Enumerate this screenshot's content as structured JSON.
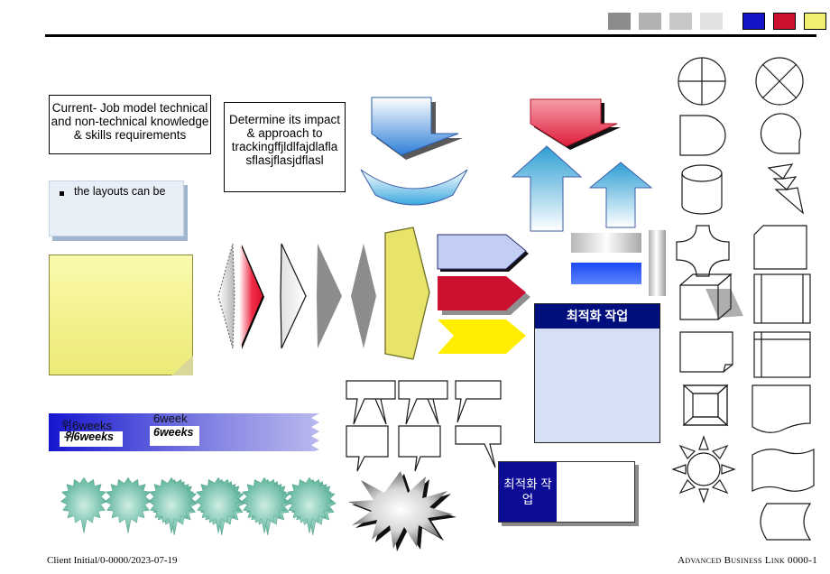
{
  "slide": {
    "title_rule": true,
    "footer_left": "Client Initial/0-0000/2023-07-19",
    "footer_right": "Advanced Business Link  0000-1"
  },
  "swatches": [
    {
      "name": "gray-dark",
      "color": "#8c8c8c",
      "bordered": false
    },
    {
      "name": "gray-mid",
      "color": "#b2b2b2",
      "bordered": false
    },
    {
      "name": "gray-light",
      "color": "#c8c8c8",
      "bordered": false
    },
    {
      "name": "gray-pale",
      "color": "#e2e2e2",
      "bordered": false
    },
    {
      "name": "blue",
      "color": "#1414c8",
      "bordered": true
    },
    {
      "name": "red",
      "color": "#cc1130",
      "bordered": true
    },
    {
      "name": "yellow",
      "color": "#f0ef72",
      "bordered": true
    },
    {
      "name": "teal",
      "color": "#0b6d68",
      "bordered": true
    }
  ],
  "boxes": {
    "current_job": "Current- Job model technical and non-technical knowledge & skills requirements",
    "determine": "Determine its impact & approach to trackingffjldlfajdlafla sflasjflasjdflasl",
    "layouts_bullet": "the layouts can be"
  },
  "banner": {
    "label_top_left": "위6weeks",
    "label_top_right": "6week",
    "label_box_left": "위6weeks",
    "label_box_right": "6weeks"
  },
  "korean": {
    "panel1_title": "최적화 작업",
    "panel2_title": "최적화 작업"
  },
  "starbursts": [
    {
      "name": "starburst-teal",
      "color": "#79c9b4"
    },
    {
      "name": "starburst-yellow",
      "color": "#e8e36a"
    },
    {
      "name": "starburst-white",
      "color": "#ffffff"
    },
    {
      "name": "starburst-navy",
      "color": "#10426f"
    },
    {
      "name": "starburst-blue",
      "color": "#1a1aa8"
    },
    {
      "name": "starburst-red",
      "color": "#d61133"
    }
  ],
  "chevrons": [
    {
      "name": "chevron-lightblue",
      "color": "#c3cef5"
    },
    {
      "name": "chevron-red",
      "color": "#cc1130"
    },
    {
      "name": "chevron-yellow",
      "color": "#ffee00"
    }
  ],
  "arrows": {
    "down_blue": "down-arrow-blue",
    "down_red": "down-arrow-red",
    "up_blue_tall": "up-arrow-blue",
    "up_blue_short": "up-arrow-blue-small",
    "curved_blue": "curved-down-arrow-blue"
  },
  "gradient_bars": {
    "gray": "gradient-bar-gray",
    "blue": "gradient-bar-blue",
    "vertical": "gradient-bar-vertical-gray"
  },
  "shape_gallery": [
    "circle-quartered",
    "circle-crossed",
    "d-shape",
    "q-shape",
    "cylinder",
    "lightning-bolt",
    "curved-cross",
    "clipped-rectangle",
    "cube-3d",
    "framed-rectangle-vertical",
    "folded-corner-rectangle",
    "framed-rectangle-corner",
    "bevel-square",
    "wave-bottom-rectangle",
    "sun-burst",
    "flag-wave",
    "rounded-tab-shape"
  ],
  "callouts": [
    "callout-box-1",
    "callout-box-2",
    "callout-box-3",
    "callout-box-4",
    "callout-box-5",
    "callout-box-6"
  ],
  "diamonds": [
    {
      "name": "diamond-dotted",
      "fill": "gradient-gray"
    },
    {
      "name": "diamond-red",
      "fill": "#ef2c45"
    },
    {
      "name": "diamond-white",
      "fill": "gradient-white"
    },
    {
      "name": "diamond-gray-1",
      "fill": "#8c8c8c"
    },
    {
      "name": "diamond-gray-2",
      "fill": "#8c8c8c"
    },
    {
      "name": "pentagon-yellow",
      "fill": "#e8e36a"
    }
  ],
  "explosion": "explosion-starburst"
}
